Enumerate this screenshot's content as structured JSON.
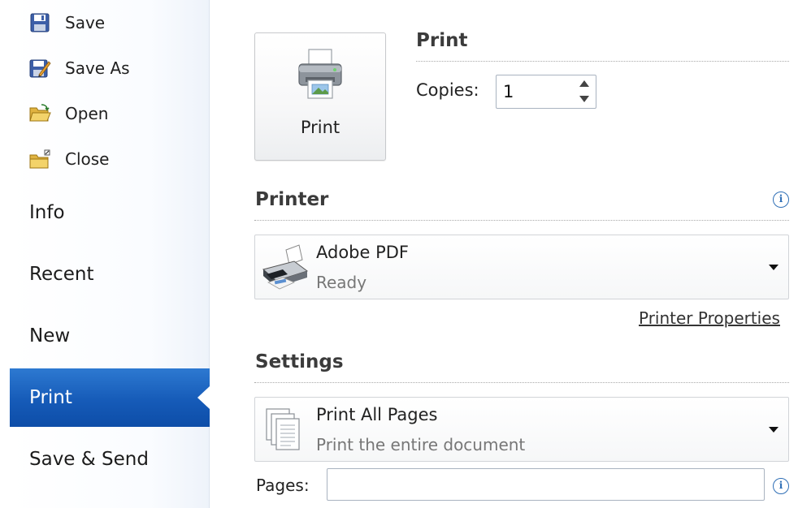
{
  "sidebar": {
    "commands": [
      {
        "label": "Save",
        "icon": "floppy-disk-icon"
      },
      {
        "label": "Save As",
        "icon": "save-as-icon"
      },
      {
        "label": "Open",
        "icon": "open-folder-icon"
      },
      {
        "label": "Close",
        "icon": "close-folder-icon"
      }
    ],
    "tabs": [
      {
        "label": "Info"
      },
      {
        "label": "Recent"
      },
      {
        "label": "New"
      },
      {
        "label": "Print",
        "active": true
      },
      {
        "label": "Save & Send"
      }
    ]
  },
  "print": {
    "button_label": "Print",
    "heading": "Print",
    "copies_label": "Copies:",
    "copies_value": "1"
  },
  "printer": {
    "heading": "Printer",
    "name": "Adobe PDF",
    "status": "Ready",
    "properties_link": "Printer Properties"
  },
  "settings": {
    "heading": "Settings",
    "range_title": "Print All Pages",
    "range_subtitle": "Print the entire document",
    "pages_label": "Pages:",
    "pages_value": ""
  },
  "colors": {
    "active_tab": "#165bb8",
    "info_icon": "#2f6fb6"
  }
}
